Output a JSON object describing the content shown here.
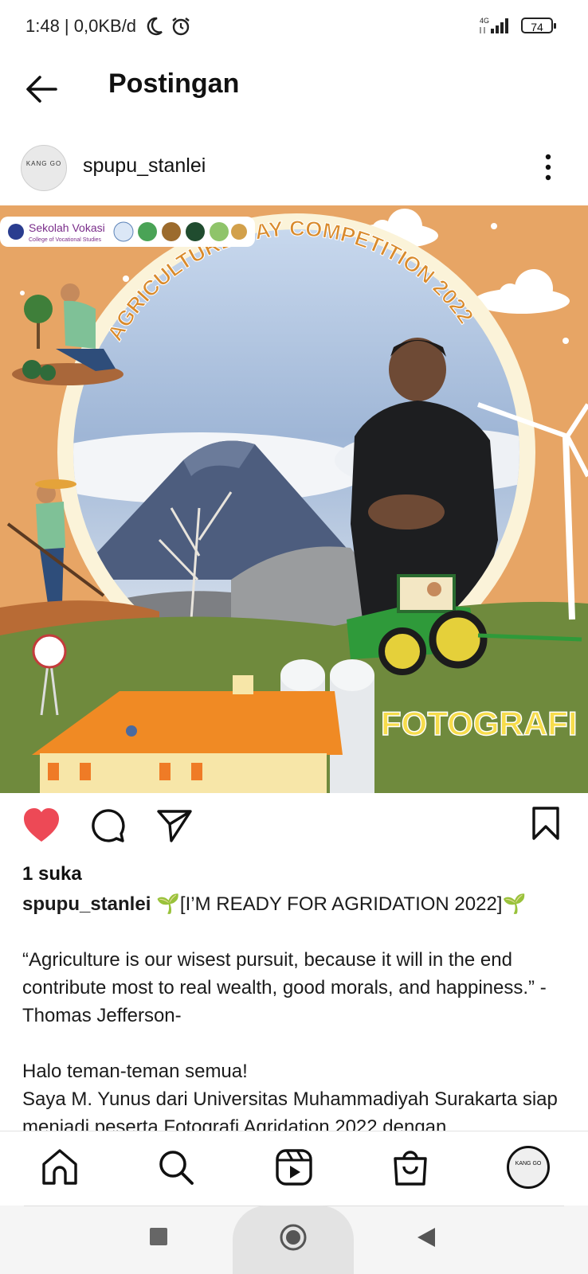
{
  "status_bar": {
    "time": "1:48 | 0,0KB/d",
    "network": "4G",
    "battery": "74",
    "icons": [
      "moon-icon",
      "alarm-icon",
      "signal-icon",
      "battery-icon"
    ]
  },
  "header": {
    "title": "Postingan"
  },
  "post": {
    "username": "spupu_stanlei",
    "avatar_text": "KANG GO",
    "image": {
      "badge_org": "Sekolah Vokasi",
      "badge_sub": "College of Vocational Studies",
      "arc_title": "AGRICULTURE DAY COMPETITION 2022",
      "category": "FOTOGRAFI"
    },
    "likes": "1 suka",
    "caption_user": "spupu_stanlei",
    "caption_text": " 🌱[I’M READY FOR AGRIDATION 2022]🌱\n\n“Agriculture is our wisest pursuit, because it will in the end contribute most to real wealth, good morals, and happiness.” -Thomas Jefferson-\n\nHalo teman-teman semua!\nSaya M. Yunus dari Universitas Muhammadiyah Surakarta siap menjadi peserta Fotografi Agridation 2022 dengan"
  },
  "colors": {
    "like_red": "#ed4956",
    "poster_orange": "#e7a565",
    "poster_green": "#6f8a3d",
    "text": "#111111"
  }
}
